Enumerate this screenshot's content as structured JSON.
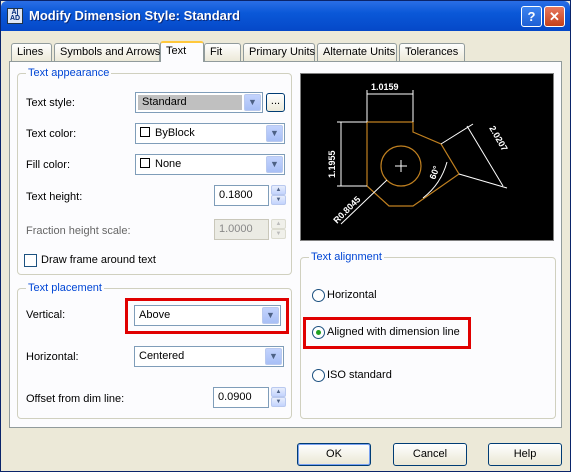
{
  "window": {
    "title": "Modify Dimension Style: Standard",
    "icon_text": "A|\nAD",
    "help_glyph": "?",
    "close_glyph": "✕"
  },
  "tabs": [
    {
      "label": "Lines"
    },
    {
      "label": "Symbols and Arrows"
    },
    {
      "label": "Text"
    },
    {
      "label": "Fit"
    },
    {
      "label": "Primary Units"
    },
    {
      "label": "Alternate Units"
    },
    {
      "label": "Tolerances"
    }
  ],
  "active_tab": "Text",
  "text_appearance": {
    "legend": "Text appearance",
    "style_label": "Text style:",
    "style_value": "Standard",
    "style_browse": "...",
    "color_label": "Text color:",
    "color_value": "ByBlock",
    "fill_label": "Fill color:",
    "fill_value": "None",
    "height_label": "Text height:",
    "height_value": "0.1800",
    "fraction_label": "Fraction height scale:",
    "fraction_value": "1.0000",
    "frame_label": "Draw frame around text",
    "frame_checked": false
  },
  "text_placement": {
    "legend": "Text placement",
    "vertical_label": "Vertical:",
    "vertical_value": "Above",
    "horizontal_label": "Horizontal:",
    "horizontal_value": "Centered",
    "offset_label": "Offset from dim line:",
    "offset_value": "0.0900"
  },
  "text_alignment": {
    "legend": "Text alignment",
    "options": [
      {
        "label": "Horizontal",
        "checked": false
      },
      {
        "label": "Aligned with dimension line",
        "checked": true
      },
      {
        "label": "ISO standard",
        "checked": false
      }
    ]
  },
  "preview": {
    "dim_top": "1.0159",
    "dim_left": "1.1955",
    "dim_right": "2.0207",
    "dim_angle": "60°",
    "dim_radius": "R0.8045"
  },
  "buttons": {
    "ok": "OK",
    "cancel": "Cancel",
    "help": "Help"
  },
  "colors": {
    "highlight": "#e00000",
    "legend_text": "#0046d5",
    "preview_dim": "#ffffff",
    "preview_geometry": "#c08020"
  }
}
